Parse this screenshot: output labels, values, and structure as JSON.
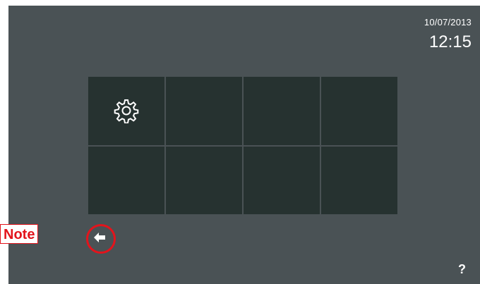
{
  "status": {
    "date": "10/07/2013",
    "time": "12:15"
  },
  "grid": {
    "tiles": [
      {
        "id": "settings",
        "icon": "gear-icon",
        "label": ""
      },
      {
        "id": "empty-2",
        "icon": "",
        "label": ""
      },
      {
        "id": "empty-3",
        "icon": "",
        "label": ""
      },
      {
        "id": "empty-4",
        "icon": "",
        "label": ""
      },
      {
        "id": "empty-5",
        "icon": "",
        "label": ""
      },
      {
        "id": "empty-6",
        "icon": "",
        "label": ""
      },
      {
        "id": "empty-7",
        "icon": "",
        "label": ""
      },
      {
        "id": "empty-8",
        "icon": "",
        "label": ""
      }
    ]
  },
  "navigation": {
    "back_icon": "arrow-left-icon",
    "help_label": "?"
  },
  "annotation": {
    "note_label": "Note",
    "highlight_color": "#e3141c"
  },
  "colors": {
    "screen_background": "#4a5255",
    "tile_background": "#263230",
    "text": "#ffffff"
  }
}
